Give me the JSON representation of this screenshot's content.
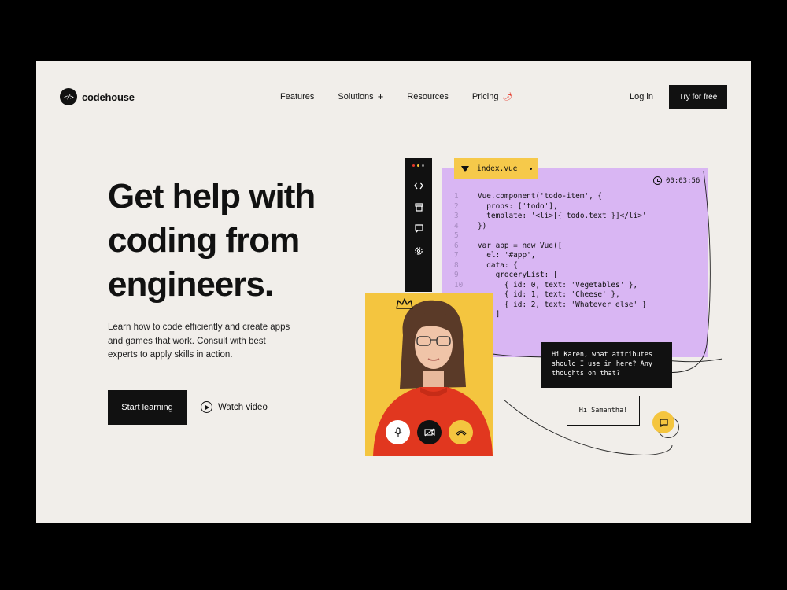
{
  "brand": {
    "name": "codehouse",
    "logo_glyph": "</>"
  },
  "nav": {
    "items": [
      {
        "label": "Features"
      },
      {
        "label": "Solutions",
        "suffix": "+"
      },
      {
        "label": "Resources"
      },
      {
        "label": "Pricing",
        "suffix": "🌶"
      }
    ],
    "login": "Log in",
    "try": "Try for free"
  },
  "hero": {
    "headline": [
      "Get help with",
      "coding from",
      "engineers."
    ],
    "subtext": "Learn how to code efficiently and create apps and games that work. Consult with best experts to apply skills in action.",
    "cta": "Start learning",
    "watch": "Watch video"
  },
  "editor": {
    "file": "index.vue",
    "timer": "00:03:56",
    "sidebar_icons": [
      "code-icon",
      "archive-icon",
      "message-icon",
      "settings-icon"
    ],
    "window_dots": [
      "#e5392a",
      "#f4c53f",
      "#8a8a8a"
    ],
    "code": [
      {
        "n": "1",
        "text": "Vue.component('todo-item', {"
      },
      {
        "n": "2",
        "text": "  props: ['todo'],"
      },
      {
        "n": "3",
        "text": "  template: '<li>[{ todo.text }]</li>'"
      },
      {
        "n": "4",
        "text": "})"
      },
      {
        "n": "5",
        "text": ""
      },
      {
        "n": "6",
        "text": "var app = new Vue(["
      },
      {
        "n": "7",
        "text": "  el: '#app',"
      },
      {
        "n": "8",
        "text": "  data: {"
      },
      {
        "n": "9",
        "text": "    groceryList: ["
      },
      {
        "n": "10",
        "text": "      { id: 0, text: 'Vegetables' },"
      },
      {
        "n": "",
        "text": "      { id: 1, text: 'Cheese' },"
      },
      {
        "n": "",
        "text": "      { id: 2, text: 'Whatever else' }"
      },
      {
        "n": "",
        "text": "    ]"
      },
      {
        "n": "",
        "text": "  }"
      },
      {
        "n": "",
        "text": "})"
      }
    ]
  },
  "chat": {
    "question": [
      "Hi Karen, what attributes",
      "should I use in here? Any",
      "thoughts on that?"
    ],
    "reply": "Hi Samantha!"
  },
  "colors": {
    "accent_yellow": "#f4c53f",
    "code_purple": "#d9b6f3",
    "ink": "#111111",
    "paper": "#f1eeea"
  }
}
